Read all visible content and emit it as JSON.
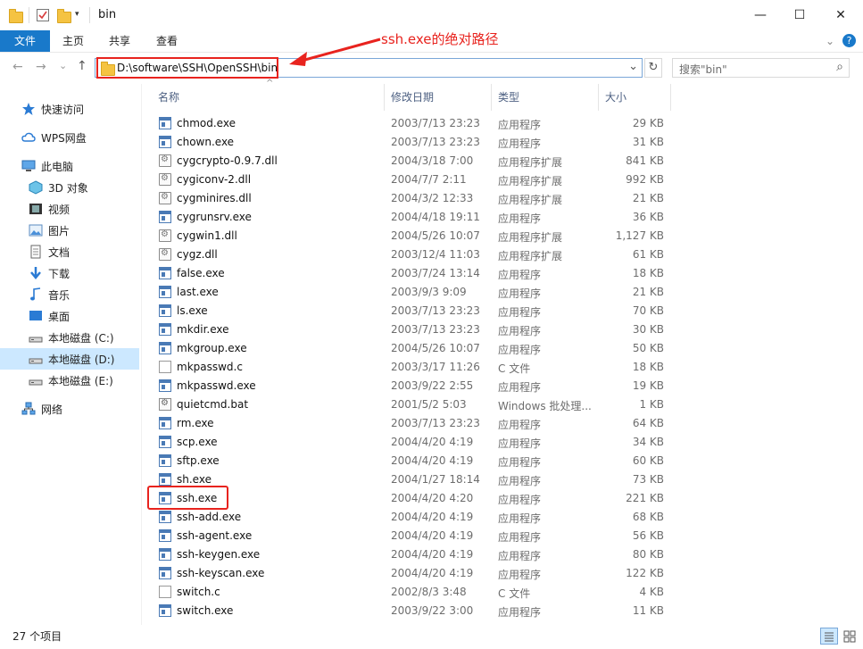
{
  "window": {
    "title": "bin",
    "minimize": "—",
    "maximize": "☐",
    "close": "✕"
  },
  "ribbon": {
    "tabs": [
      "文件",
      "主页",
      "共享",
      "查看"
    ],
    "expand": "⌄",
    "help": "?"
  },
  "nav": {
    "back": "←",
    "forward": "→",
    "recent": "⌄",
    "up": "↑",
    "address": "D:\\software\\SSH\\OpenSSH\\bin",
    "address_dropdown": "⌄",
    "refresh": "↻",
    "search_placeholder": "搜索\"bin\"",
    "search_icon": "⌕"
  },
  "annotation": {
    "text": "ssh.exe的绝对路径",
    "color": "#e8231e"
  },
  "navpane": {
    "items": [
      {
        "label": "快速访问",
        "icon": "star-icon"
      },
      {
        "label": "WPS网盘",
        "icon": "cloud-icon"
      },
      {
        "label": "此电脑",
        "icon": "computer-icon"
      },
      {
        "label": "3D 对象",
        "icon": "cube-icon"
      },
      {
        "label": "视频",
        "icon": "video-icon"
      },
      {
        "label": "图片",
        "icon": "picture-icon"
      },
      {
        "label": "文档",
        "icon": "document-icon"
      },
      {
        "label": "下载",
        "icon": "download-icon"
      },
      {
        "label": "音乐",
        "icon": "music-icon"
      },
      {
        "label": "桌面",
        "icon": "desktop-icon"
      },
      {
        "label": "本地磁盘 (C:)",
        "icon": "drive-icon"
      },
      {
        "label": "本地磁盘 (D:)",
        "icon": "drive-icon",
        "selected": true
      },
      {
        "label": "本地磁盘 (E:)",
        "icon": "drive-icon"
      },
      {
        "label": "网络",
        "icon": "network-icon"
      }
    ]
  },
  "filelist": {
    "columns": {
      "name": "名称",
      "date": "修改日期",
      "type": "类型",
      "size": "大小"
    },
    "sort_indicator": "^",
    "files": [
      {
        "name": "chmod.exe",
        "date": "2003/7/13 23:23",
        "type": "应用程序",
        "size": "29 KB",
        "kind": "exe"
      },
      {
        "name": "chown.exe",
        "date": "2003/7/13 23:23",
        "type": "应用程序",
        "size": "31 KB",
        "kind": "exe"
      },
      {
        "name": "cygcrypto-0.9.7.dll",
        "date": "2004/3/18 7:00",
        "type": "应用程序扩展",
        "size": "841 KB",
        "kind": "dll"
      },
      {
        "name": "cygiconv-2.dll",
        "date": "2004/7/7 2:11",
        "type": "应用程序扩展",
        "size": "992 KB",
        "kind": "dll"
      },
      {
        "name": "cygminires.dll",
        "date": "2004/3/2 12:33",
        "type": "应用程序扩展",
        "size": "21 KB",
        "kind": "dll"
      },
      {
        "name": "cygrunsrv.exe",
        "date": "2004/4/18 19:11",
        "type": "应用程序",
        "size": "36 KB",
        "kind": "exe"
      },
      {
        "name": "cygwin1.dll",
        "date": "2004/5/26 10:07",
        "type": "应用程序扩展",
        "size": "1,127 KB",
        "kind": "dll"
      },
      {
        "name": "cygz.dll",
        "date": "2003/12/4 11:03",
        "type": "应用程序扩展",
        "size": "61 KB",
        "kind": "dll"
      },
      {
        "name": "false.exe",
        "date": "2003/7/24 13:14",
        "type": "应用程序",
        "size": "18 KB",
        "kind": "exe"
      },
      {
        "name": "last.exe",
        "date": "2003/9/3 9:09",
        "type": "应用程序",
        "size": "21 KB",
        "kind": "exe"
      },
      {
        "name": "ls.exe",
        "date": "2003/7/13 23:23",
        "type": "应用程序",
        "size": "70 KB",
        "kind": "exe"
      },
      {
        "name": "mkdir.exe",
        "date": "2003/7/13 23:23",
        "type": "应用程序",
        "size": "30 KB",
        "kind": "exe"
      },
      {
        "name": "mkgroup.exe",
        "date": "2004/5/26 10:07",
        "type": "应用程序",
        "size": "50 KB",
        "kind": "exe"
      },
      {
        "name": "mkpasswd.c",
        "date": "2003/3/17 11:26",
        "type": "C 文件",
        "size": "18 KB",
        "kind": "c"
      },
      {
        "name": "mkpasswd.exe",
        "date": "2003/9/22 2:55",
        "type": "应用程序",
        "size": "19 KB",
        "kind": "exe"
      },
      {
        "name": "quietcmd.bat",
        "date": "2001/5/2 5:03",
        "type": "Windows 批处理...",
        "size": "1 KB",
        "kind": "bat"
      },
      {
        "name": "rm.exe",
        "date": "2003/7/13 23:23",
        "type": "应用程序",
        "size": "64 KB",
        "kind": "exe"
      },
      {
        "name": "scp.exe",
        "date": "2004/4/20 4:19",
        "type": "应用程序",
        "size": "34 KB",
        "kind": "exe"
      },
      {
        "name": "sftp.exe",
        "date": "2004/4/20 4:19",
        "type": "应用程序",
        "size": "60 KB",
        "kind": "exe"
      },
      {
        "name": "sh.exe",
        "date": "2004/1/27 18:14",
        "type": "应用程序",
        "size": "73 KB",
        "kind": "exe"
      },
      {
        "name": "ssh.exe",
        "date": "2004/4/20 4:20",
        "type": "应用程序",
        "size": "221 KB",
        "kind": "exe",
        "highlighted": true
      },
      {
        "name": "ssh-add.exe",
        "date": "2004/4/20 4:19",
        "type": "应用程序",
        "size": "68 KB",
        "kind": "exe"
      },
      {
        "name": "ssh-agent.exe",
        "date": "2004/4/20 4:19",
        "type": "应用程序",
        "size": "56 KB",
        "kind": "exe"
      },
      {
        "name": "ssh-keygen.exe",
        "date": "2004/4/20 4:19",
        "type": "应用程序",
        "size": "80 KB",
        "kind": "exe"
      },
      {
        "name": "ssh-keyscan.exe",
        "date": "2004/4/20 4:19",
        "type": "应用程序",
        "size": "122 KB",
        "kind": "exe"
      },
      {
        "name": "switch.c",
        "date": "2002/8/3 3:48",
        "type": "C 文件",
        "size": "4 KB",
        "kind": "c"
      },
      {
        "name": "switch.exe",
        "date": "2003/9/22 3:00",
        "type": "应用程序",
        "size": "11 KB",
        "kind": "exe"
      }
    ]
  },
  "status": {
    "item_count": "27 个项目"
  }
}
